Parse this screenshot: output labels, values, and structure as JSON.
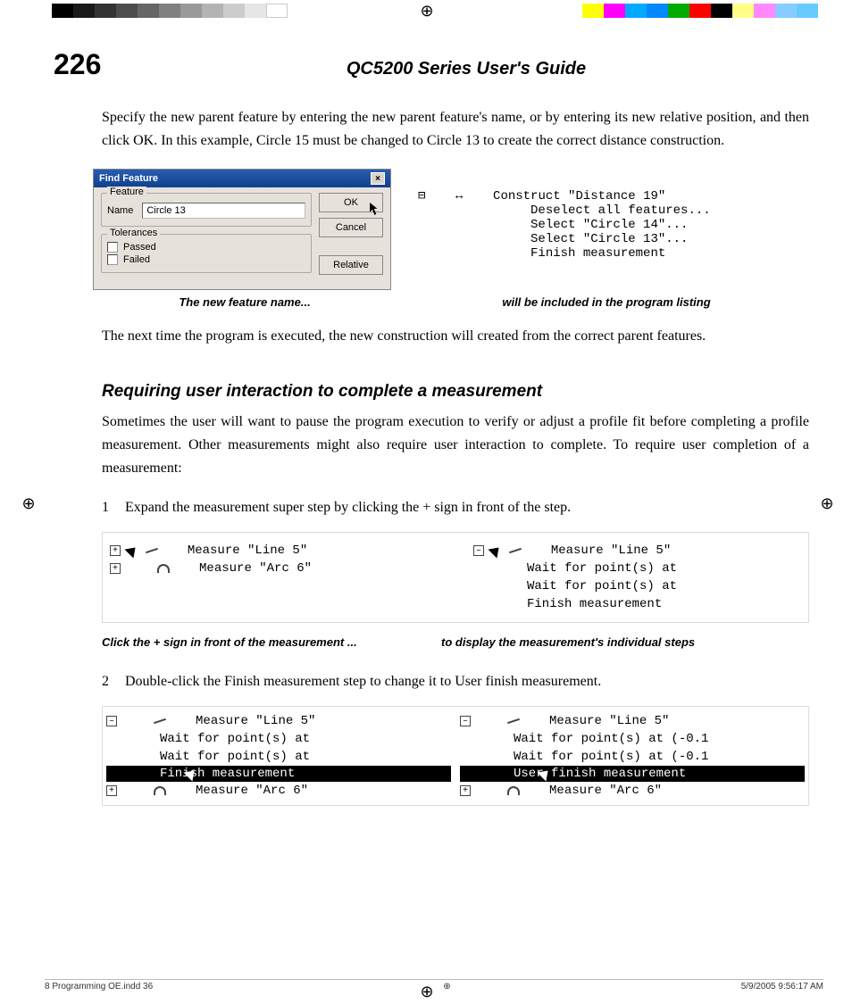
{
  "header": {
    "page_number": "226",
    "title": "QC5200 Series User's Guide"
  },
  "para1": "Specify the new parent feature by entering the new parent feature's name, or by entering its new relative position, and then click OK.  In this example, Circle 15 must be changed to Circle 13 to create the correct distance construction.",
  "dialog": {
    "title": "Find Feature",
    "group_feature": "Feature",
    "name_label": "Name",
    "name_value": "Circle 13",
    "group_tol": "Tolerances",
    "passed": "Passed",
    "failed": "Failed",
    "ok": "OK",
    "cancel": "Cancel",
    "relative": "Relative"
  },
  "code1": {
    "l1": "⊟    ↔    Construct \"Distance 19\"",
    "l2": "               Deselect all features...",
    "l3": "               Select \"Circle 14\"...",
    "l4": "               Select \"Circle 13\"...",
    "l5": "               Finish measurement"
  },
  "cap1_left": "The new feature name...",
  "cap1_right": "will be included in the program listing",
  "para2": "The next time the program is executed, the new construction will created from the correct parent features.",
  "section2": "Requiring user interaction to complete a measurement",
  "para3": "Sometimes the user will want to pause the program execution to verify or adjust a profile fit before completing a profile measurement. Other measurements might also require user interaction to complete.  To require user completion of a measurement:",
  "step1_num": "1",
  "step1": "Expand the measurement super step by clicking the + sign in front of the step.",
  "fig2_left": {
    "l1": "Measure \"Line 5\"",
    "l2": "Measure \"Arc 6\""
  },
  "fig2_right": {
    "l1": "Measure \"Line 5\"",
    "l2": "Wait for point(s) at",
    "l3": "Wait for point(s) at",
    "l4": "Finish measurement"
  },
  "cap2_left": "Click the + sign in front of the measurement ...",
  "cap2_right": "to display the measurement's individual steps",
  "step2_num": "2",
  "step2": "Double-click the Finish measurement step to change it to User finish measurement.",
  "fig3_left": {
    "l1": "Measure \"Line 5\"",
    "l2": "Wait for point(s) at",
    "l3": "Wait for point(s) at",
    "hl": "Finish measurement",
    "l5": "Measure \"Arc 6\""
  },
  "fig3_right": {
    "l1": "Measure \"Line 5\"",
    "l2": "Wait for point(s) at  (-0.1",
    "l3": "Wait for point(s) at  (-0.1",
    "hl": "User finish measurement",
    "l5": "Measure \"Arc 6\""
  },
  "footer": {
    "left": "8 Programming OE.indd   36",
    "right": "5/9/2005   9:56:17 AM"
  }
}
